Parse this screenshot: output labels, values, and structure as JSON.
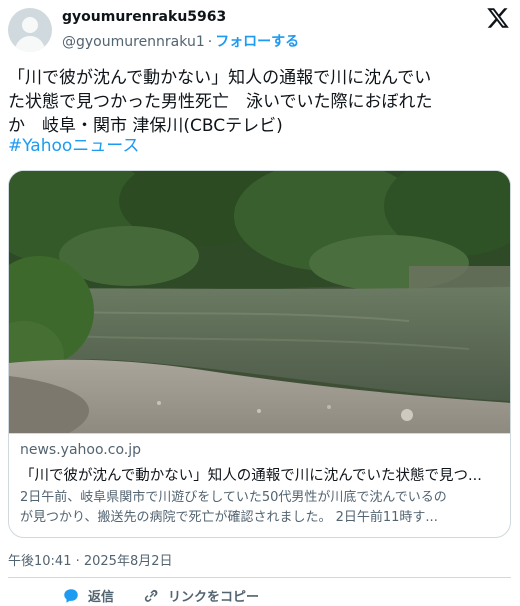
{
  "author": {
    "display_name": "gyoumurenraku5963",
    "handle": "@gyoumurennraku1",
    "separator": "·",
    "follow_label": "フォローする"
  },
  "tweet": {
    "lines": [
      "「川で彼が沈んで動かない」知人の通報で川に沈んでい",
      "た状態で見つかった男性死亡　泳いでいた際におぼれた",
      "か　岐阜・関市 津保川(CBCテレビ)"
    ],
    "hashtag": "#Yahooニュース",
    "timestamp": "午後10:41 · 2025年8月2日"
  },
  "card": {
    "domain": "news.yahoo.co.jp",
    "title": "「川で彼が沈んで動かない」知人の通報で川に沈んでいた状態で見つ...",
    "description_lines": [
      "2日午前、岐阜県関市で川遊びをしていた50代男性が川底で沈んでいるの",
      "が見つかり、搬送先の病院で死亡が確認されました。 2日午前11時す..."
    ]
  },
  "actions": {
    "reply_label": "返信",
    "copy_link_label": "リンクをコピー"
  },
  "icons": {
    "x_logo": "x-logo-icon",
    "reply": "speech-bubble-icon",
    "copy_link": "link-chain-icon"
  },
  "colors": {
    "accent": "#1d9bf0",
    "text_primary": "#0f1419",
    "text_secondary": "#536471",
    "border": "#cfd9de"
  }
}
